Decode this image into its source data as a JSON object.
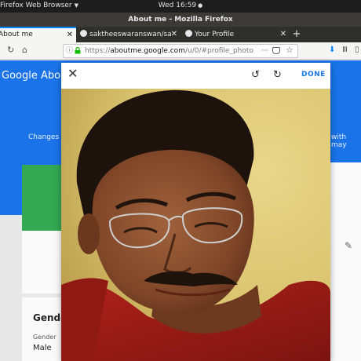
{
  "system": {
    "app_menu": "Firefox Web Browser",
    "clock": "Wed 16:59"
  },
  "window": {
    "title": "About me - Mozilla Firefox"
  },
  "tabs": [
    {
      "label": "About me",
      "active": true
    },
    {
      "label": "saktheeswaranswan/saktheeswaranswan",
      "active": false
    },
    {
      "label": "Your Profile",
      "active": false
    }
  ],
  "navbar": {
    "url_prefix": "https://",
    "url_host": "aboutme.google.com",
    "url_path": "/u/0/#profile_photo",
    "more_label": "···"
  },
  "page": {
    "brand": "Google About me",
    "changes_text": "Changes",
    "with_may_text": "with may",
    "gender_title": "Gender",
    "gender_label": "Gender",
    "gender_value": "Male"
  },
  "dialog": {
    "done_label": "DONE"
  },
  "colors": {
    "accent": "#1a73e8",
    "tab_accent": "#0a84ff",
    "green_card": "#34a853"
  }
}
